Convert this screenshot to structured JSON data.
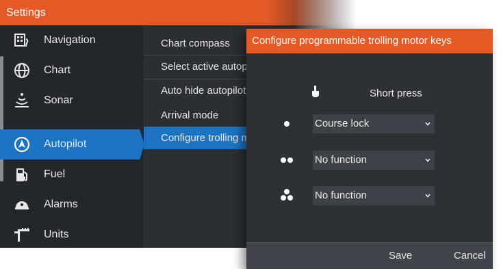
{
  "settings": {
    "title": "Settings",
    "sidebar": [
      {
        "label": "Navigation",
        "icon": "navigation-icon"
      },
      {
        "label": "Chart",
        "icon": "globe-icon"
      },
      {
        "label": "Sonar",
        "icon": "sonar-icon"
      },
      {
        "label": "Autopilot",
        "icon": "autopilot-icon",
        "active": true
      },
      {
        "label": "Fuel",
        "icon": "fuel-pump-icon"
      },
      {
        "label": "Alarms",
        "icon": "alarm-icon"
      },
      {
        "label": "Units",
        "icon": "units-icon"
      }
    ],
    "submenu": [
      {
        "label": "Chart compass"
      },
      {
        "label": "Select active autopilot"
      },
      {
        "label": "Auto hide autopilot"
      },
      {
        "label": "Arrival mode"
      },
      {
        "label": "Configure trolling motor keys",
        "active": true
      }
    ]
  },
  "dialog": {
    "title": "Configure programmable trolling motor keys",
    "column_heading": "Short press",
    "rows": [
      {
        "key": "single-dot",
        "value": "Course lock"
      },
      {
        "key": "double-dot",
        "value": "No function"
      },
      {
        "key": "triple-dot",
        "value": "No function"
      }
    ],
    "save_label": "Save",
    "cancel_label": "Cancel"
  },
  "colors": {
    "accent_orange": "#e45a26",
    "selection_blue": "#1c73c2",
    "panel_dark": "#23262b"
  }
}
